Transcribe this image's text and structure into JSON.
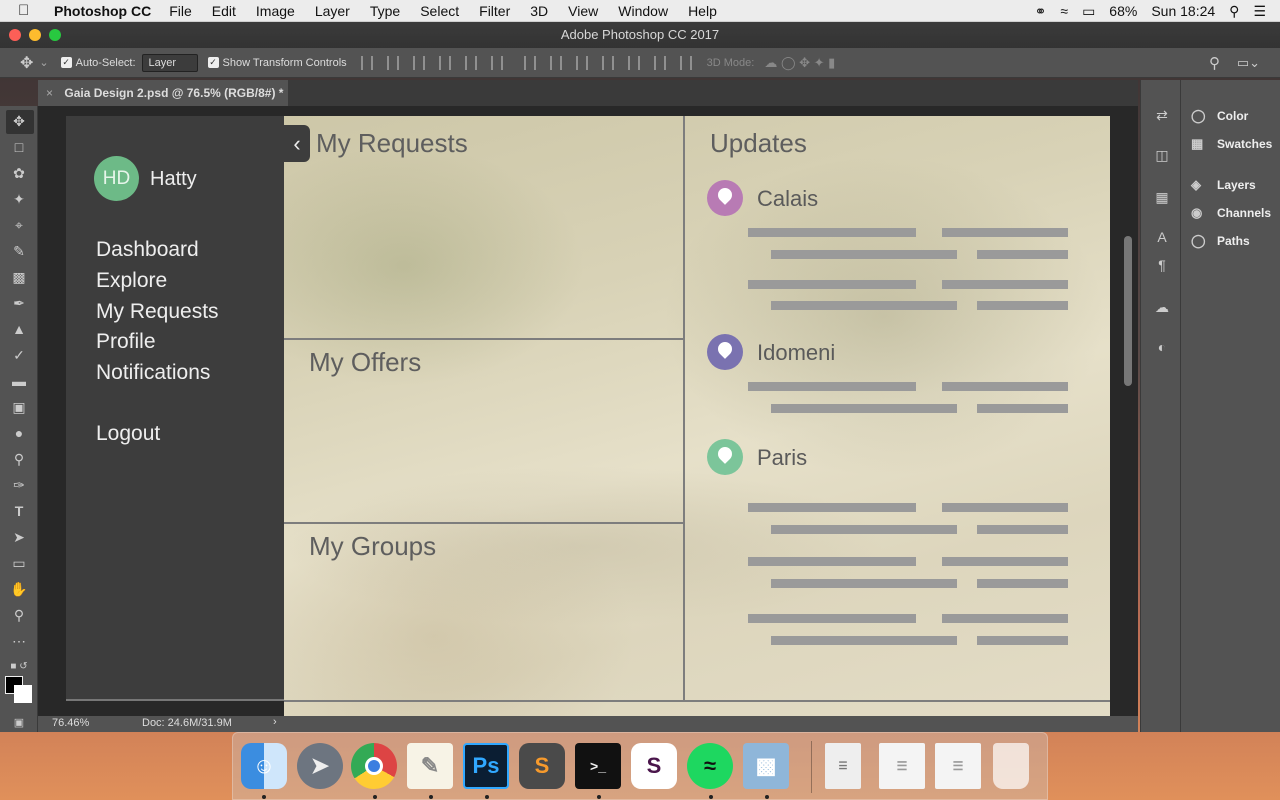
{
  "menubar": {
    "app_name": "Photoshop CC",
    "items": [
      "File",
      "Edit",
      "Image",
      "Layer",
      "Type",
      "Select",
      "Filter",
      "3D",
      "View",
      "Window",
      "Help"
    ],
    "battery": "68%",
    "clock": "Sun 18:24"
  },
  "window": {
    "title": "Adobe Photoshop CC 2017"
  },
  "options_bar": {
    "auto_select_label": "Auto-Select:",
    "auto_select_value": "Layer",
    "show_transform_label": "Show Transform Controls",
    "mode_label": "3D Mode:"
  },
  "document": {
    "tab_label": "Gaia Design 2.psd @ 76.5% (RGB/8#) *",
    "zoom": "76.46%",
    "doc_size": "Doc: 24.6M/31.9M"
  },
  "panels": {
    "items": [
      "Color",
      "Swatches",
      "Layers",
      "Channels",
      "Paths"
    ]
  },
  "design": {
    "user_initials": "HD",
    "user_name": "Hatty",
    "nav": [
      "Dashboard",
      "Explore",
      "My Requests",
      "Profile",
      "Notifications"
    ],
    "logout": "Logout",
    "sections": {
      "requests": "My Requests",
      "offers": "My Offers",
      "groups": "My Groups",
      "updates": "Updates"
    },
    "cities": [
      {
        "name": "Calais",
        "color": "#b87bb4"
      },
      {
        "name": "Idomeni",
        "color": "#7a72b0"
      },
      {
        "name": "Paris",
        "color": "#7cc59a"
      }
    ]
  },
  "dock": {
    "items": [
      "finder-icon",
      "launchpad-icon",
      "chrome-icon",
      "textedit-icon",
      "photoshop-icon",
      "sublime-icon",
      "terminal-icon",
      "slack-icon",
      "spotify-icon",
      "preview-icon",
      "docx-icon",
      "document-icon",
      "document-icon",
      "trash-icon"
    ]
  }
}
